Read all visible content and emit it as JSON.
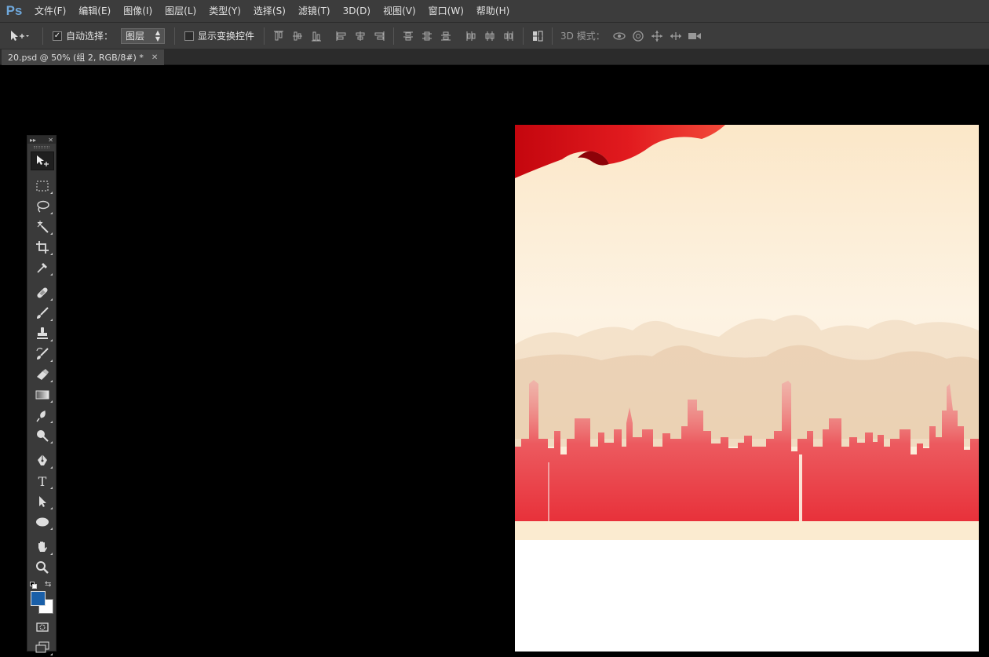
{
  "app": {
    "logo": "Ps"
  },
  "menu": [
    "文件(F)",
    "编辑(E)",
    "图像(I)",
    "图层(L)",
    "类型(Y)",
    "选择(S)",
    "滤镜(T)",
    "3D(D)",
    "视图(V)",
    "窗口(W)",
    "帮助(H)"
  ],
  "options": {
    "auto_select_label": "自动选择：",
    "auto_select_checked": true,
    "auto_select_target": "图层",
    "show_transform_label": "显示变换控件",
    "show_transform_checked": false,
    "mode_3d_label": "3D 模式："
  },
  "document": {
    "tab_title": "20.psd @ 50% (组 2, RGB/8#) *"
  },
  "toolbox": {
    "tools": [
      "move",
      "rectangular-marquee",
      "lasso",
      "magic-wand",
      "crop",
      "eyedropper",
      "spot-healing-brush",
      "brush",
      "clone-stamp",
      "history-brush",
      "eraser",
      "gradient",
      "blur",
      "dodge",
      "pen",
      "type",
      "path-selection",
      "ellipse",
      "hand",
      "zoom"
    ],
    "active_tool": "move",
    "foreground_color": "#1a5fa8",
    "background_color": "#ffffff"
  },
  "colors": {
    "ui_bg": "#3c3c3c",
    "canvas_bg": "#000000",
    "banner_red": "#e8313a",
    "cream": "#fbebd0"
  }
}
